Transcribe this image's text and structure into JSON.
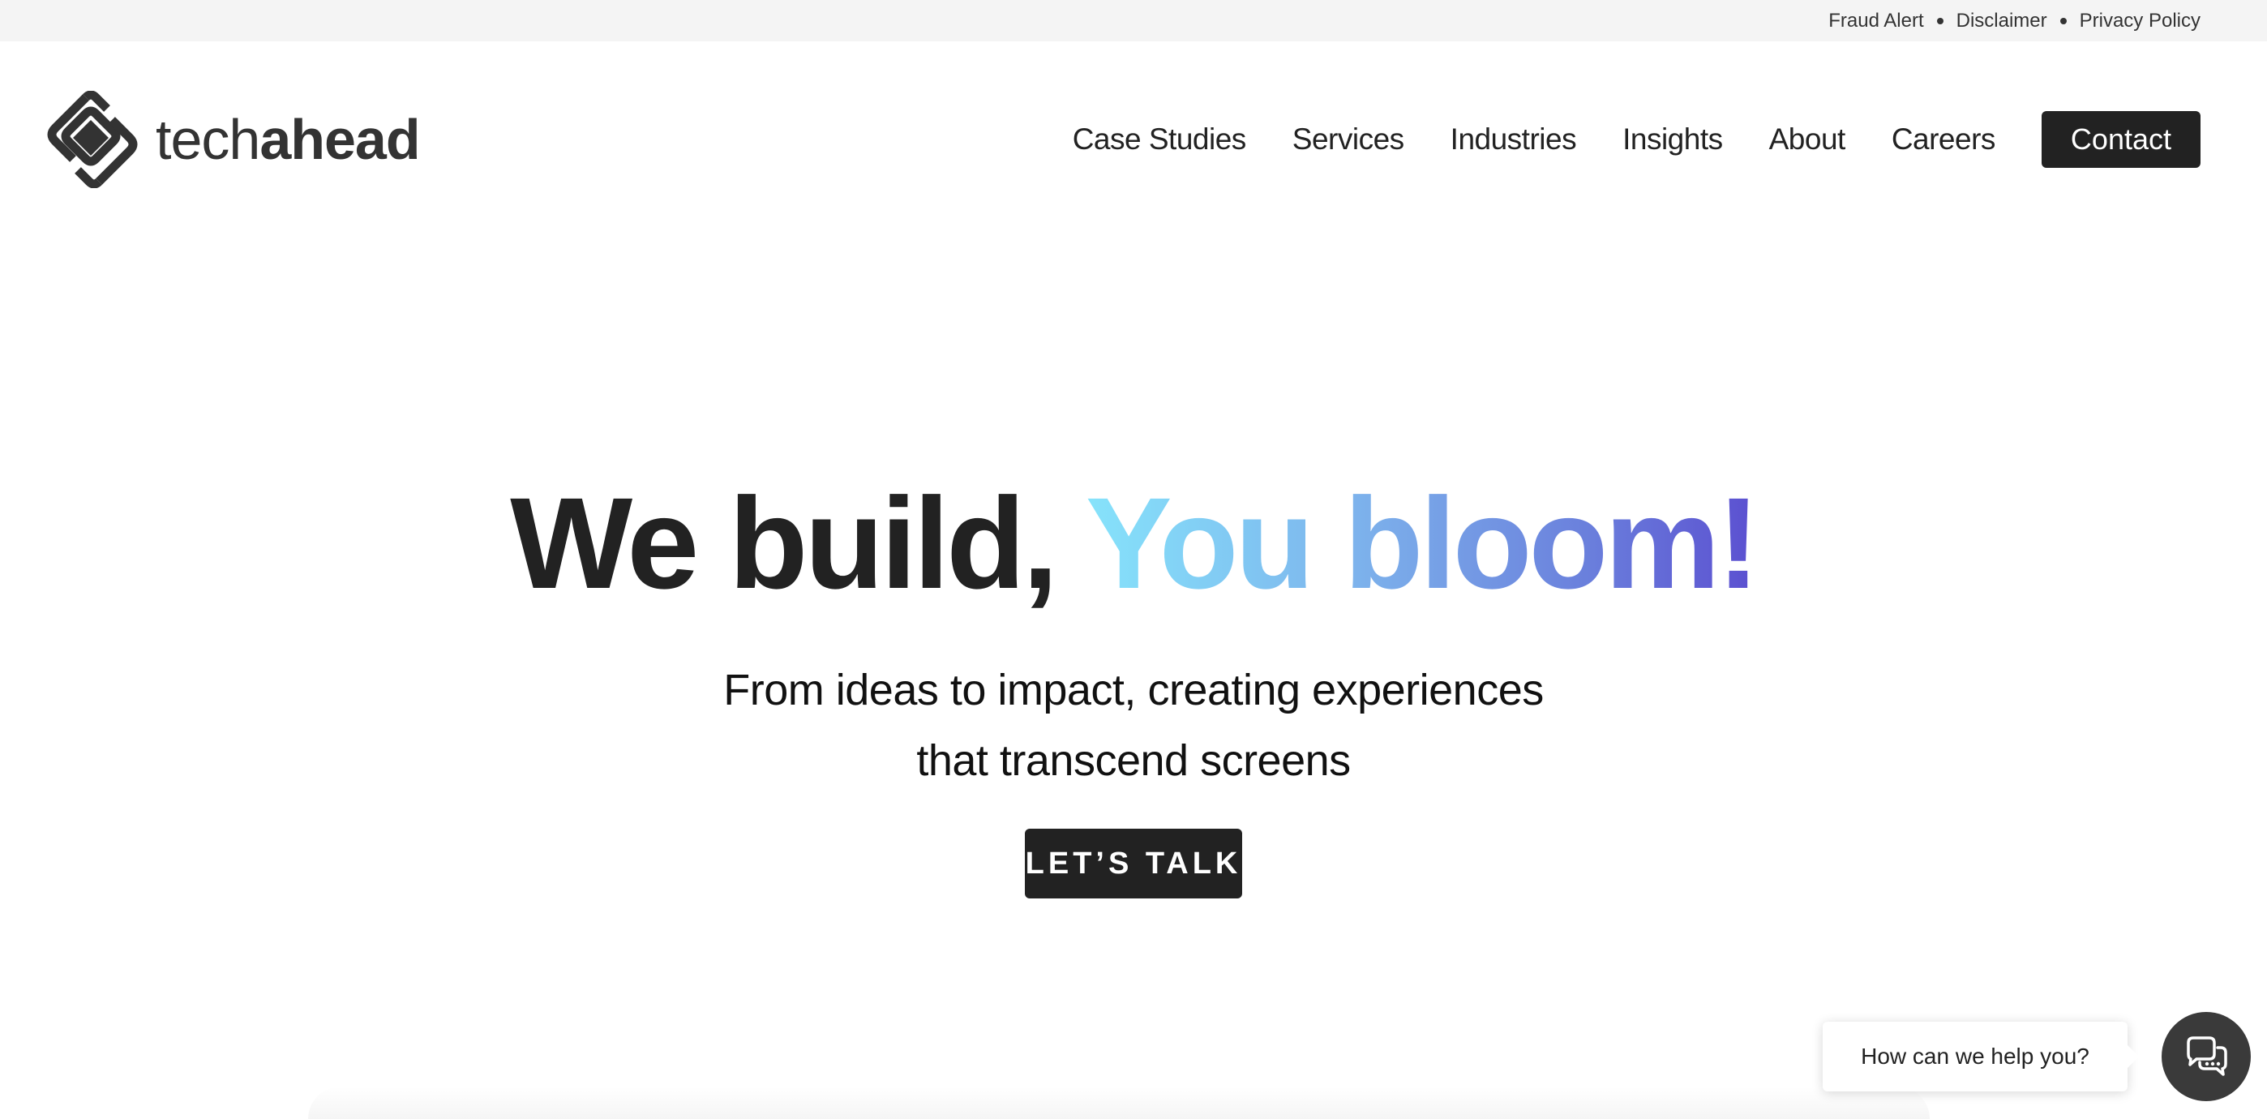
{
  "utility_bar": {
    "links": [
      "Fraud Alert",
      "Disclaimer",
      "Privacy Policy"
    ]
  },
  "logo": {
    "text_light": "tech",
    "text_bold": "ahead",
    "icon": "techahead-logo-icon"
  },
  "nav": {
    "items": [
      "Case Studies",
      "Services",
      "Industries",
      "Insights",
      "About",
      "Careers"
    ],
    "contact_label": "Contact"
  },
  "hero": {
    "headline_dark": "We build,",
    "headline_gradient": "You bloom!",
    "subtitle_line1": "From ideas to impact, creating experiences",
    "subtitle_line2": "that transcend screens",
    "cta_label": "LET’S TALK"
  },
  "chat": {
    "prompt": "How can we help you?",
    "icon": "chat-bubbles-icon"
  },
  "colors": {
    "dark": "#222222",
    "utility_bg": "#f4f4f4",
    "gradient_start": "#86e3fb",
    "gradient_end": "#5b4fd0",
    "chat_launcher": "#3a3a3a"
  }
}
